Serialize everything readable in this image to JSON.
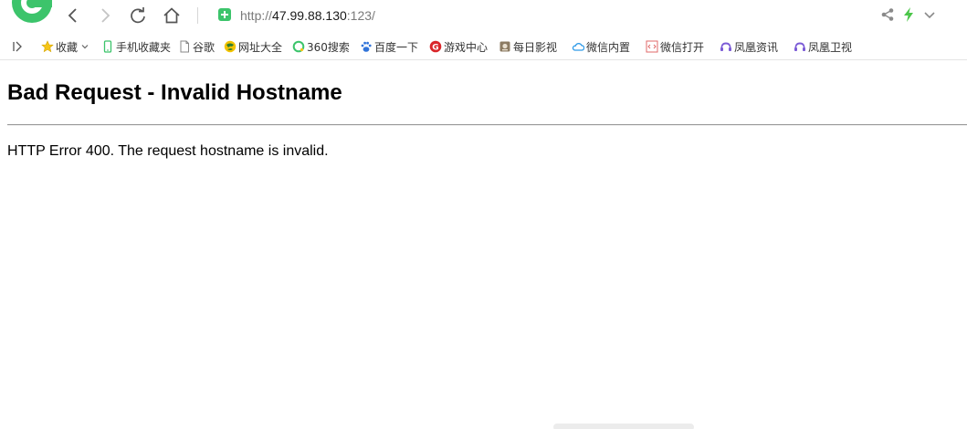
{
  "navbar": {
    "url_scheme": "http://",
    "url_host": "47.99.88.130",
    "url_path": ":123/",
    "icons": [
      "browser-logo-icon",
      "back-icon",
      "forward-icon",
      "reload-icon",
      "home-icon",
      "shield-icon",
      "share-icon",
      "bolt-icon",
      "chevron-down-icon"
    ]
  },
  "bookmarks": {
    "items": [
      {
        "label": "收藏",
        "icon": "star-icon"
      },
      {
        "label": "手机收藏夹",
        "icon": "phone-icon"
      },
      {
        "label": "谷歌",
        "icon": "page-icon"
      },
      {
        "label": "网址大全",
        "icon": "globe-icon"
      },
      {
        "label": "360搜索",
        "icon": "search-icon"
      },
      {
        "label": "百度一下",
        "icon": "paw-icon"
      },
      {
        "label": "游戏中心",
        "icon": "game-icon"
      },
      {
        "label": "每日影视",
        "icon": "film-icon"
      },
      {
        "label": "微信内置",
        "icon": "cloud-icon"
      },
      {
        "label": "微信打开",
        "icon": "code-icon"
      },
      {
        "label": "凤凰资讯",
        "icon": "phoenix-icon"
      },
      {
        "label": "凤凰卫视",
        "icon": "phoenix-icon"
      }
    ]
  },
  "content": {
    "title": "Bad Request - Invalid Hostname",
    "message": "HTTP Error 400. The request hostname is invalid."
  },
  "colors": {
    "accent_green": "#3cc46b",
    "bolt_green": "#4cc64a",
    "text": "#000000",
    "url_gray": "#7a7a7a"
  }
}
